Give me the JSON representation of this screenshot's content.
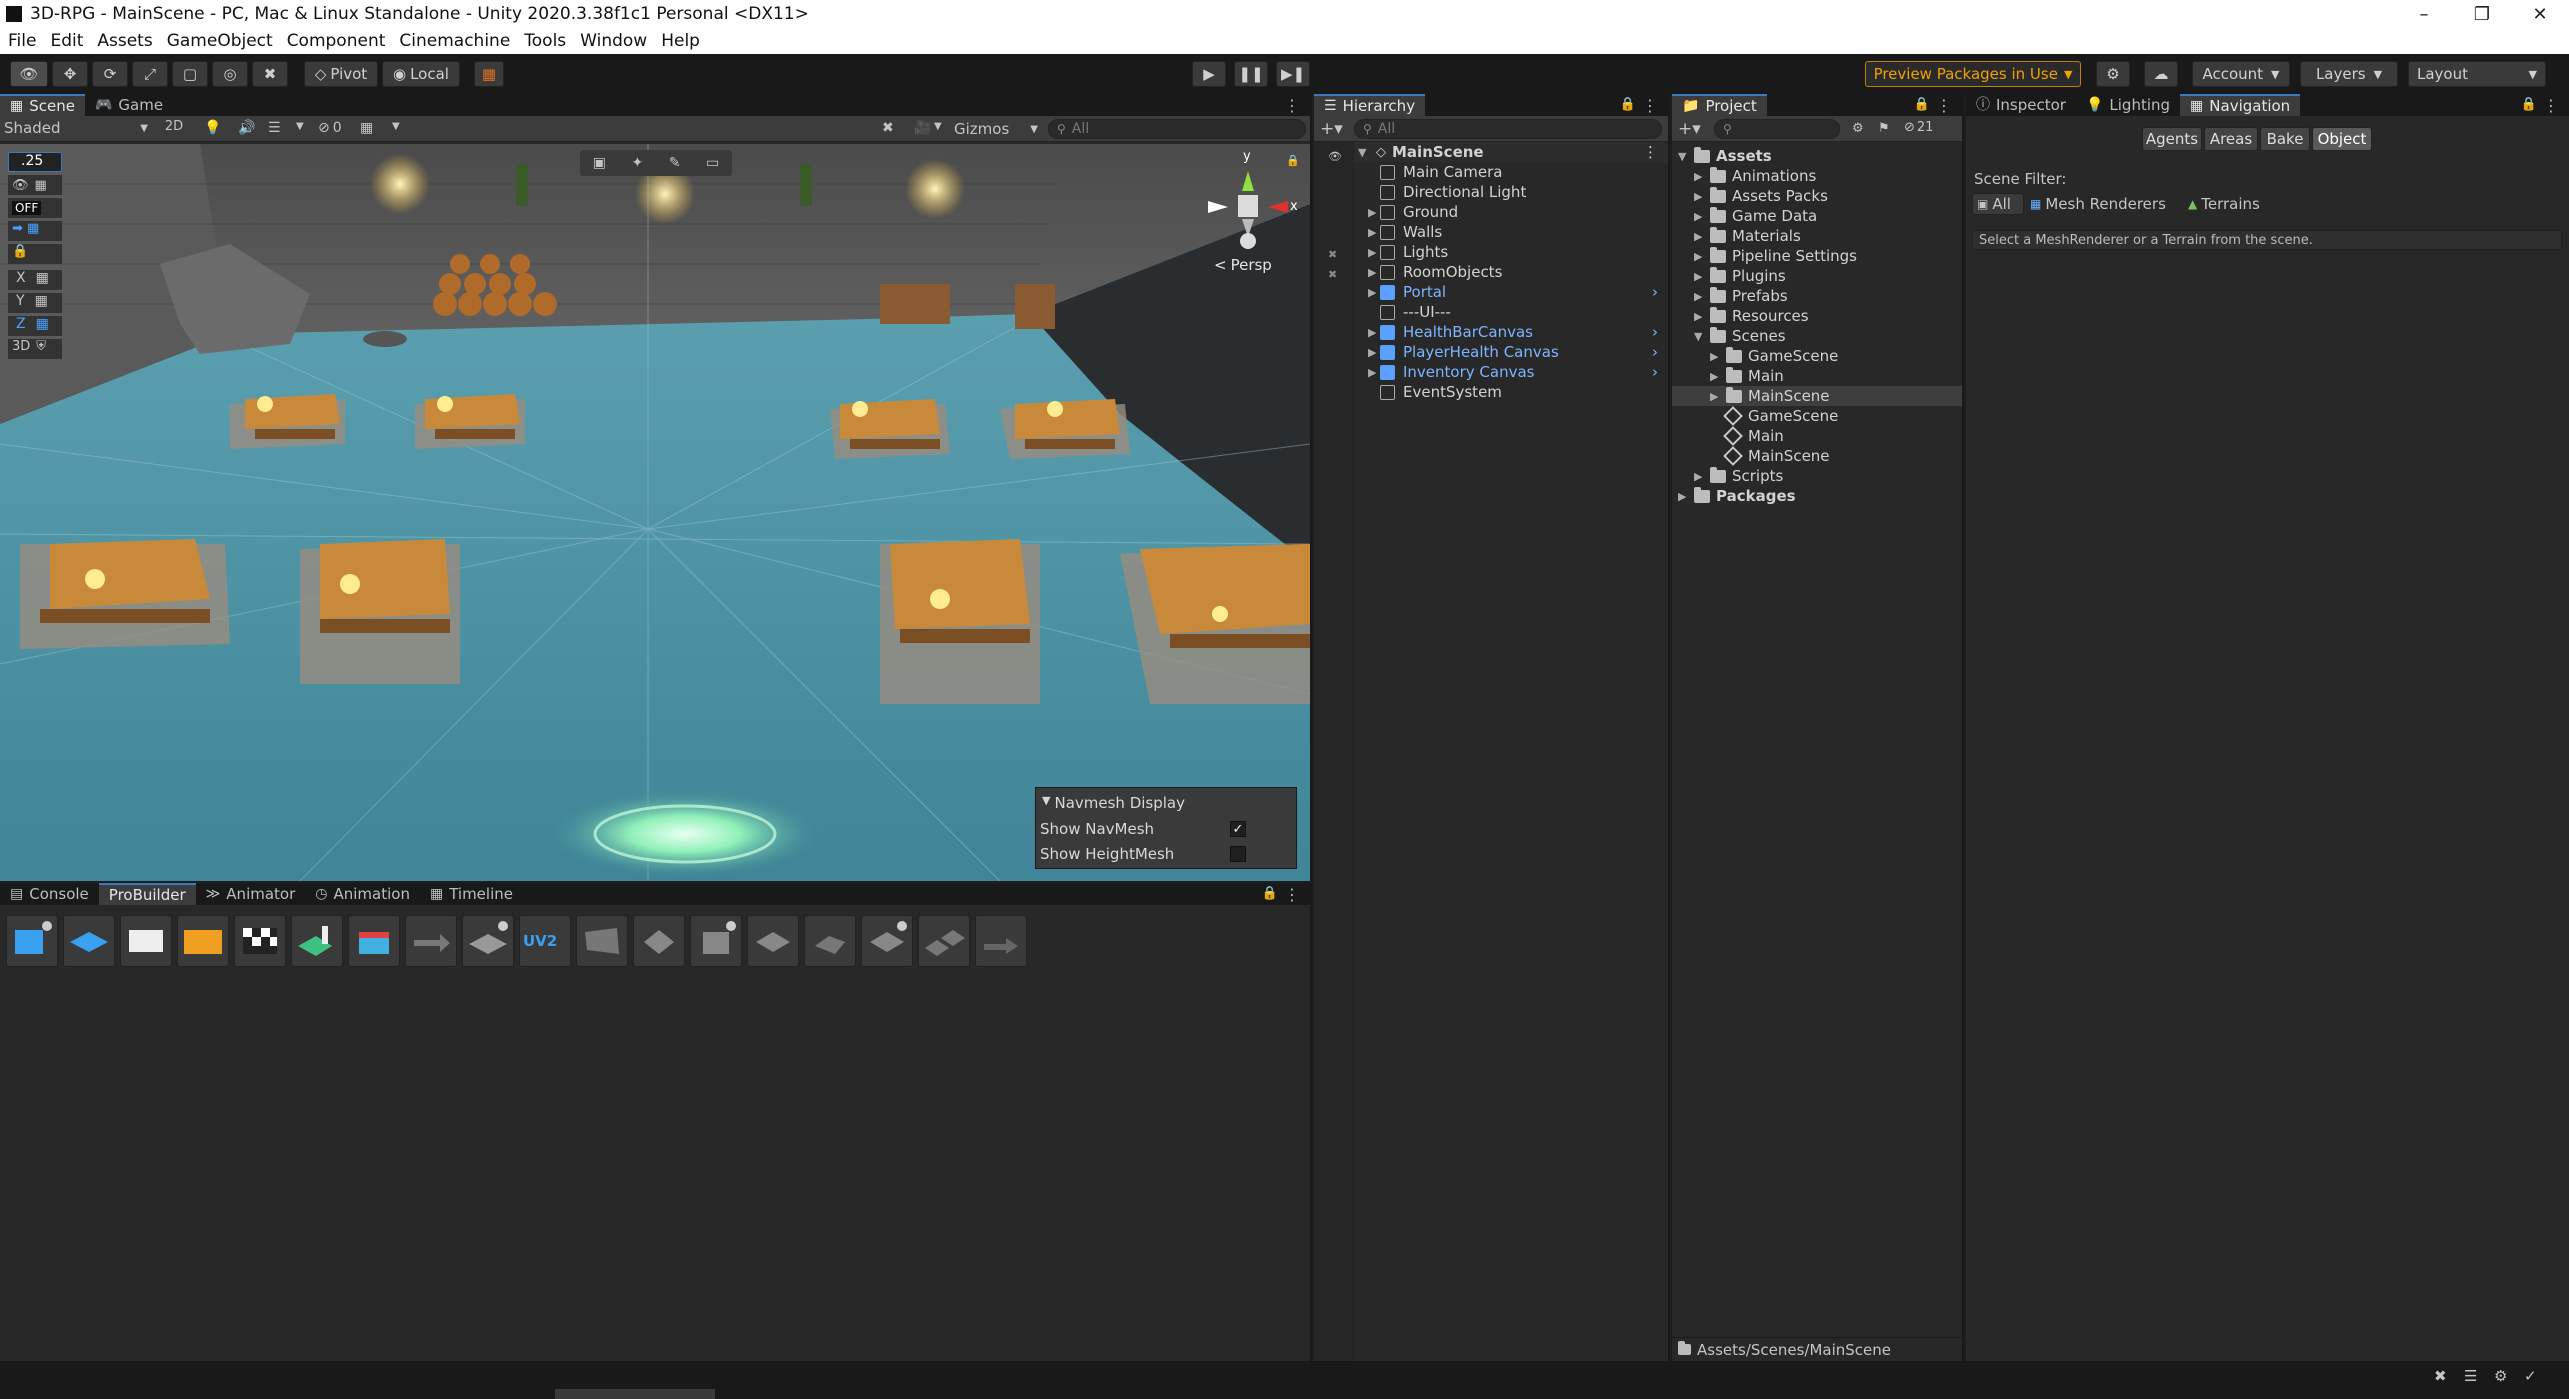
{
  "window": {
    "title": "3D-RPG - MainScene - PC, Mac & Linux Standalone - Unity 2020.3.38f1c1 Personal <DX11>"
  },
  "menu": [
    "File",
    "Edit",
    "Assets",
    "GameObject",
    "Component",
    "Cinemachine",
    "Tools",
    "Window",
    "Help"
  ],
  "toolbar": {
    "pivot": "Pivot",
    "local": "Local",
    "preview_packages": "Preview Packages in Use",
    "account": "Account",
    "layers": "Layers",
    "layout": "Layout"
  },
  "scene_panel": {
    "tabs": [
      "Scene",
      "Game"
    ],
    "shading": "Shaded",
    "mode_2d": "2D",
    "hidden_count": "0",
    "gizmos": "Gizmos",
    "search_placeholder": "All",
    "snap_value": ".25",
    "off_label": "OFF",
    "axes": [
      "X",
      "Y",
      "Z"
    ],
    "label_3d": "3D",
    "gizmo_x": "x",
    "gizmo_y": "y",
    "projection": "Persp"
  },
  "navmesh_display": {
    "title": "Navmesh Display",
    "show_navmesh": "Show NavMesh",
    "show_navmesh_checked": true,
    "show_heightmesh": "Show HeightMesh",
    "show_heightmesh_checked": false
  },
  "bottom_panel": {
    "tabs": [
      "Console",
      "ProBuilder",
      "Animator",
      "Animation",
      "Timeline"
    ],
    "active": "ProBuilder",
    "uv2_label": "UV2"
  },
  "hierarchy": {
    "title": "Hierarchy",
    "search_placeholder": "All",
    "root": "MainScene",
    "items": [
      {
        "label": "Main Camera",
        "prefab": false,
        "expandable": false
      },
      {
        "label": "Directional Light",
        "prefab": false,
        "expandable": false
      },
      {
        "label": "Ground",
        "prefab": false,
        "expandable": true
      },
      {
        "label": "Walls",
        "prefab": false,
        "expandable": true
      },
      {
        "label": "Lights",
        "prefab": false,
        "expandable": true
      },
      {
        "label": "RoomObjects",
        "prefab": false,
        "expandable": true
      },
      {
        "label": "Portal",
        "prefab": true,
        "expandable": true
      },
      {
        "label": "---UI---",
        "prefab": false,
        "expandable": false
      },
      {
        "label": "HealthBarCanvas",
        "prefab": true,
        "expandable": true
      },
      {
        "label": "PlayerHealth Canvas",
        "prefab": true,
        "expandable": true
      },
      {
        "label": "Inventory Canvas",
        "prefab": true,
        "expandable": true
      },
      {
        "label": "EventSystem",
        "prefab": false,
        "expandable": false
      }
    ]
  },
  "project": {
    "title": "Project",
    "hidden_count": "21",
    "tree": [
      {
        "label": "Assets",
        "level": 0,
        "type": "folder",
        "bold": true,
        "open": true
      },
      {
        "label": "Animations",
        "level": 1,
        "type": "folder"
      },
      {
        "label": "Assets Packs",
        "level": 1,
        "type": "folder"
      },
      {
        "label": "Game Data",
        "level": 1,
        "type": "folder"
      },
      {
        "label": "Materials",
        "level": 1,
        "type": "folder"
      },
      {
        "label": "Pipeline Settings",
        "level": 1,
        "type": "folder"
      },
      {
        "label": "Plugins",
        "level": 1,
        "type": "folder"
      },
      {
        "label": "Prefabs",
        "level": 1,
        "type": "folder"
      },
      {
        "label": "Resources",
        "level": 1,
        "type": "folder"
      },
      {
        "label": "Scenes",
        "level": 1,
        "type": "folder",
        "open": true
      },
      {
        "label": "GameScene",
        "level": 2,
        "type": "folder"
      },
      {
        "label": "Main",
        "level": 2,
        "type": "folder"
      },
      {
        "label": "MainScene",
        "level": 2,
        "type": "folder",
        "selected": true
      },
      {
        "label": "GameScene",
        "level": 2,
        "type": "scene"
      },
      {
        "label": "Main",
        "level": 2,
        "type": "scene"
      },
      {
        "label": "MainScene",
        "level": 2,
        "type": "scene"
      },
      {
        "label": "Scripts",
        "level": 1,
        "type": "folder"
      },
      {
        "label": "Packages",
        "level": 0,
        "type": "folder",
        "bold": true
      }
    ],
    "footer_path": "Assets/Scenes/MainScene"
  },
  "right_panel": {
    "tabs": [
      "Inspector",
      "Lighting",
      "Navigation"
    ],
    "active_tab": "Navigation",
    "nav_buttons": [
      "Agents",
      "Areas",
      "Bake",
      "Object"
    ],
    "active_button": "Object",
    "scene_filter_label": "Scene Filter:",
    "filter_options": [
      "All",
      "Mesh Renderers",
      "Terrains"
    ],
    "help_text": "Select a MeshRenderer or a Terrain from the scene."
  },
  "colors": {
    "accent": "#3a79bb",
    "prefab_text": "#7cb5ff",
    "preview_packages": "#f0a000",
    "floor": "#4e96a8"
  }
}
